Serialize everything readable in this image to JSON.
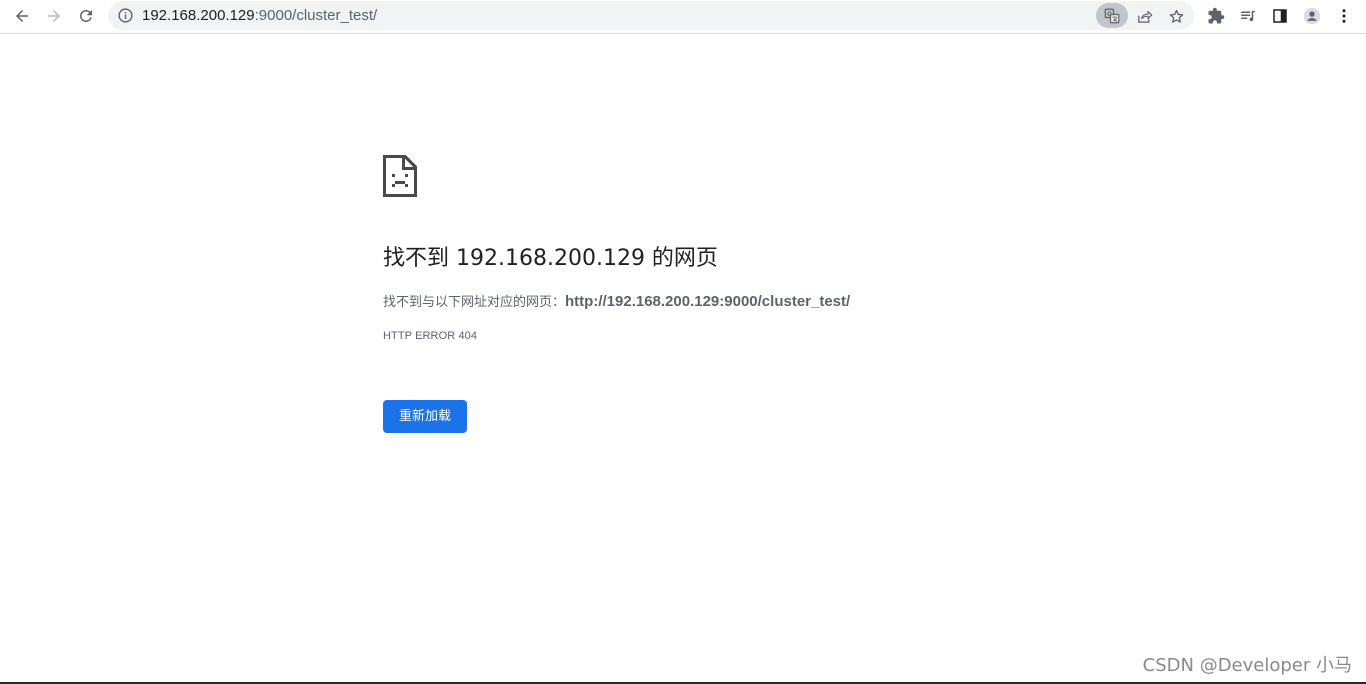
{
  "browser": {
    "address_bar": {
      "host": "192.168.200.129",
      "path": ":9000/cluster_test/"
    },
    "icons": {
      "back": "arrow-left-icon",
      "forward": "arrow-right-icon",
      "reload": "reload-icon",
      "site_info": "info-circle-icon",
      "translate": "translate-icon",
      "share": "share-icon",
      "bookmark": "star-icon",
      "extensions": "puzzle-icon",
      "media": "queue-music-icon",
      "side_panel": "side-panel-icon",
      "profile": "avatar-icon",
      "menu": "kebab-menu-icon"
    }
  },
  "error_page": {
    "icon": "sad-document-icon",
    "title": "找不到 192.168.200.129 的网页",
    "description_prefix": "找不到与以下网址对应的网页：",
    "description_url": "http://192.168.200.129:9000/cluster_test/",
    "error_code": "HTTP ERROR 404",
    "reload_button": "重新加载"
  },
  "watermark": "CSDN @Developer 小马",
  "colors": {
    "accent": "#1a73e8",
    "omnibox": "#f1f3f4",
    "text": "#202124",
    "secondary_text": "#5f6368"
  }
}
